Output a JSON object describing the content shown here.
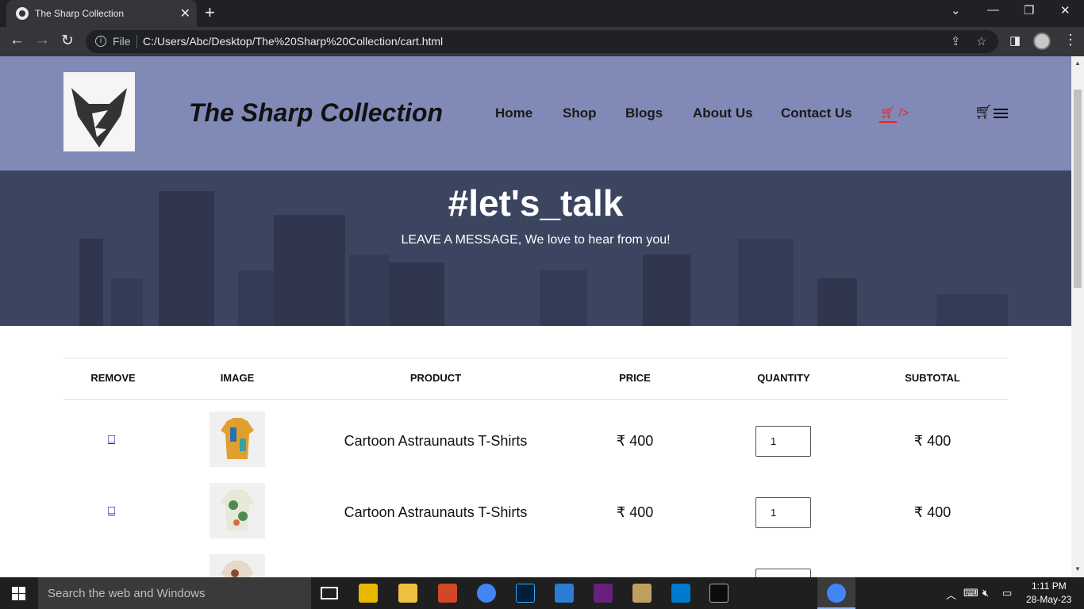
{
  "browser": {
    "tab_title": "The Sharp Collection",
    "url_scheme": "File",
    "url": "C:/Users/Abc/Desktop/The%20Sharp%20Collection/cart.html"
  },
  "site": {
    "brand": "The Sharp Collection",
    "nav": [
      {
        "label": "Home"
      },
      {
        "label": "Shop"
      },
      {
        "label": "Blogs"
      },
      {
        "label": "About Us"
      },
      {
        "label": "Contact Us"
      }
    ],
    "cart_nav_suffix": "/>"
  },
  "hero": {
    "title": "#let's_talk",
    "subtitle": "LEAVE A MESSAGE, We love to hear from you!"
  },
  "cart": {
    "headers": [
      "REMOVE",
      "IMAGE",
      "PRODUCT",
      "PRICE",
      "QUANTITY",
      "SUBTOTAL"
    ],
    "remove_glyph": "□",
    "rows": [
      {
        "product": "Cartoon Astraunauts T-Shirts",
        "price": "₹ 400",
        "quantity": "1",
        "subtotal": "₹ 400"
      },
      {
        "product": "Cartoon Astraunauts T-Shirts",
        "price": "₹ 400",
        "quantity": "1",
        "subtotal": "₹ 400"
      }
    ]
  },
  "taskbar": {
    "search_placeholder": "Search the web and Windows",
    "time": "1:11 PM",
    "date": "28-May-23"
  },
  "colors": {
    "header_bg": "#8189b7",
    "hero_bg": "#3c4560",
    "accent_red": "#e3262a"
  }
}
